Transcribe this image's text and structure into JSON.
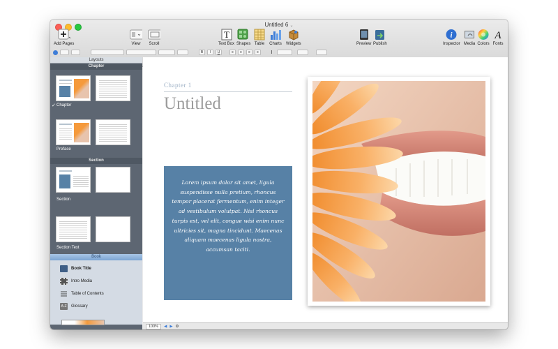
{
  "window": {
    "title": "Untitled 6",
    "title_chevron": "⌄"
  },
  "toolbar": {
    "add_pages": "Add Pages",
    "view": "View",
    "scroll": "Scroll",
    "text_box": "Text Box",
    "shapes": "Shapes",
    "table": "Table",
    "charts": "Charts",
    "widgets": "Widgets",
    "preview": "Preview",
    "publish": "Publish",
    "inspector": "Inspector",
    "media": "Media",
    "colors": "Colors",
    "fonts": "Fonts"
  },
  "sidebar": {
    "header": "Layouts",
    "sections": [
      {
        "title": "Chapter",
        "layouts": [
          "Chapter",
          "Preface"
        ]
      },
      {
        "title": "Section",
        "layouts": [
          "Section",
          "Section Text"
        ]
      }
    ],
    "checked_layout": "Chapter",
    "checkmark": "✓",
    "book": {
      "header": "Book",
      "items": [
        "Book Title",
        "Intro Media",
        "Table of Contents",
        "Glossary"
      ],
      "selected": "Book Title",
      "glossary_icon_text": "A-Z"
    }
  },
  "page": {
    "chapter_label": "Chapter 1",
    "title": "Untitled",
    "body_text": "Lorem ipsum dolor sit amet, ligula suspendisse nulla pretium, rhoncus tempor placerat fermentum, enim integer ad vestibulum volutpat. Nisl rhoncus turpis est, vel elit, congue wisi enim nunc ultricies sit, magna tincidunt. Maecenas aliquam maecenas ligula nostra, accumsan taciti."
  },
  "statusbar": {
    "zoom": "100%"
  },
  "colors": {
    "textbox_bg": "#5781a6",
    "sidebar_bg": "#5d6672",
    "title_color": "#9c9c9c",
    "petal_orange": "#f59a3c"
  }
}
